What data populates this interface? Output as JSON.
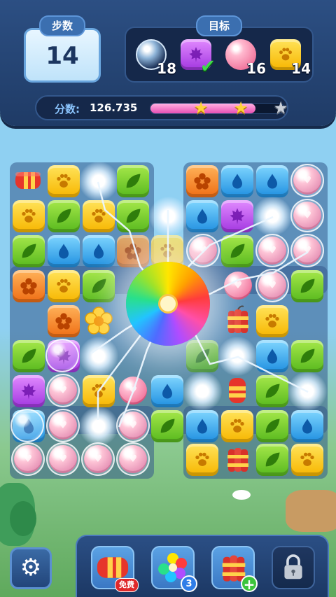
{
  "hud": {
    "moves_label": "步数",
    "moves_value": "14",
    "goal_label": "目标",
    "goals": [
      {
        "name": "bubble-goal",
        "count": "18",
        "completed": false
      },
      {
        "name": "purple-leaf-tile-goal",
        "count": "",
        "completed": true
      },
      {
        "name": "pink-ball-goal",
        "count": "16",
        "completed": false
      },
      {
        "name": "yellow-paw-tile-goal",
        "count": "14",
        "completed": false
      }
    ],
    "score_label": "分数:",
    "score_value": "126.735",
    "progress_fraction": 0.79,
    "stars_earned": 2,
    "stars_total": 3
  },
  "boosters": [
    {
      "name": "rocket-booster",
      "badge": "免费"
    },
    {
      "name": "rainbow-booster",
      "badge": "3"
    },
    {
      "name": "dynamite-booster",
      "badge": "+"
    },
    {
      "name": "locked-booster",
      "badge": ""
    }
  ],
  "colors": {
    "yellow": "#f7b500",
    "green": "#57b81e",
    "blue": "#1f8fe0",
    "orange": "#ef6d14",
    "purple": "#a236e0",
    "pink": "#ef6f98",
    "hud_bg": "#2c4f83"
  },
  "icons": {
    "settings": "gear-icon",
    "locked": "padlock-icon",
    "tile_yellow": "paw-icon",
    "tile_green": "leaf-icon",
    "tile_blue": "water-drop-icon",
    "tile_orange": "flower-icon",
    "tile_purple": "maple-leaf-icon"
  }
}
